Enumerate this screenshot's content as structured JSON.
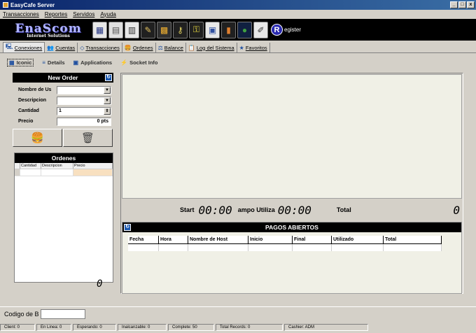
{
  "window": {
    "title": "EasyCafe Server",
    "btn_min": "_",
    "btn_max": "□",
    "btn_close": "x"
  },
  "menu": [
    "Transacciones",
    "Reportes",
    "Servidos",
    "Ayuda"
  ],
  "logo": {
    "line1": "EnaScom",
    "line2": "Internet Solutions"
  },
  "toolbar_icons": [
    "clients-icon",
    "tools-icon",
    "report-icon",
    "config-icon",
    "cafe-icon",
    "keys-icon",
    "key-icon",
    "screen-icon",
    "book-icon",
    "globe-icon",
    "note-icon"
  ],
  "register_label": "egister",
  "register_glyph": "R",
  "main_tabs": [
    {
      "label": "Conexiones",
      "icon": "🖳"
    },
    {
      "label": "Cuentas",
      "icon": "👥"
    },
    {
      "label": "Transacciones",
      "icon": "◇"
    },
    {
      "label": "Ordenes",
      "icon": "🍔"
    },
    {
      "label": "Balance",
      "icon": "⚖"
    },
    {
      "label": "Log del Sistema",
      "icon": "📋"
    },
    {
      "label": "Favoritos",
      "icon": "★"
    }
  ],
  "sub_tabs": [
    {
      "label": "Iconic"
    },
    {
      "label": "Details"
    },
    {
      "label": "Applications"
    },
    {
      "label": "Socket Info"
    }
  ],
  "new_order": {
    "title": "New Order",
    "fields": [
      {
        "label": "Nombre de Us",
        "value": ""
      },
      {
        "label": "Descripcion",
        "value": ""
      },
      {
        "label": "Cantidad",
        "value": "1"
      },
      {
        "label": "Precio",
        "value": "0 pts"
      }
    ]
  },
  "ordenes": {
    "title": "Ordenes",
    "columns": [
      "Cantidad",
      "Descripcion",
      "Precio"
    ],
    "total": "0"
  },
  "timers": {
    "start_label": "Start",
    "start_value": "00:00",
    "tiempo_label": "ampo Utiliza",
    "tiempo_value": "00:00",
    "total_label": "Total",
    "total_value": "0"
  },
  "pagos": {
    "title": "PAGOS ABIERTOS",
    "columns": [
      "Fecha",
      "Hora",
      "Nombre de Host",
      "Inicio",
      "Final",
      "Utilizado",
      "Total"
    ]
  },
  "codigo_label": "Codigo de B",
  "status": [
    "Client: 0",
    "En Linea: 0",
    "Esperando: 0",
    "Inalcanzable: 0",
    "Complete: 50",
    "Total Records: 0",
    "Cashier: ADM"
  ]
}
